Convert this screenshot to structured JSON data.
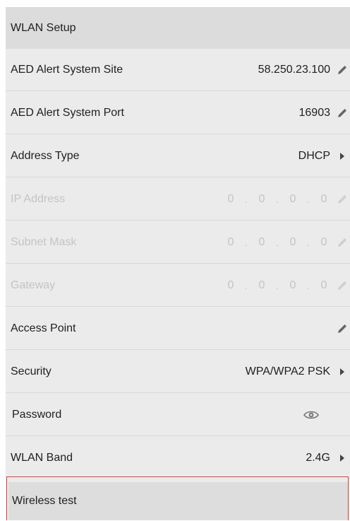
{
  "header": {
    "title": "WLAN Setup"
  },
  "rows": {
    "alert_site": {
      "label": "AED Alert System Site",
      "value": "58.250.23.100",
      "icon": "pencil-icon"
    },
    "alert_port": {
      "label": "AED Alert System Port",
      "value": "16903",
      "icon": "pencil-icon"
    },
    "address_type": {
      "label": "Address Type",
      "value": "DHCP",
      "icon": "triangle-right-icon"
    },
    "ip_address": {
      "label": "IP Address",
      "octets": [
        "0",
        "0",
        "0",
        "0"
      ],
      "icon": "pencil-icon"
    },
    "subnet_mask": {
      "label": "Subnet Mask",
      "octets": [
        "0",
        "0",
        "0",
        "0"
      ],
      "icon": "pencil-icon"
    },
    "gateway": {
      "label": "Gateway",
      "octets": [
        "0",
        "0",
        "0",
        "0"
      ],
      "icon": "pencil-icon"
    },
    "access_point": {
      "label": "Access Point",
      "value": "",
      "icon": "pencil-icon"
    },
    "security": {
      "label": "Security",
      "value": "WPA/WPA2 PSK",
      "icon": "triangle-right-icon"
    },
    "password": {
      "label": "Password",
      "icon": "eye-icon"
    },
    "wlan_band": {
      "label": "WLAN Band",
      "value": "2.4G",
      "icon": "triangle-right-icon"
    }
  },
  "footer": {
    "wireless_test_label": "Wireless test"
  },
  "colors": {
    "panel_bg": "#ebebeb",
    "header_bg": "#dcdcdc",
    "disabled_text": "#c4c4c4",
    "focus_border": "#e0403a"
  }
}
